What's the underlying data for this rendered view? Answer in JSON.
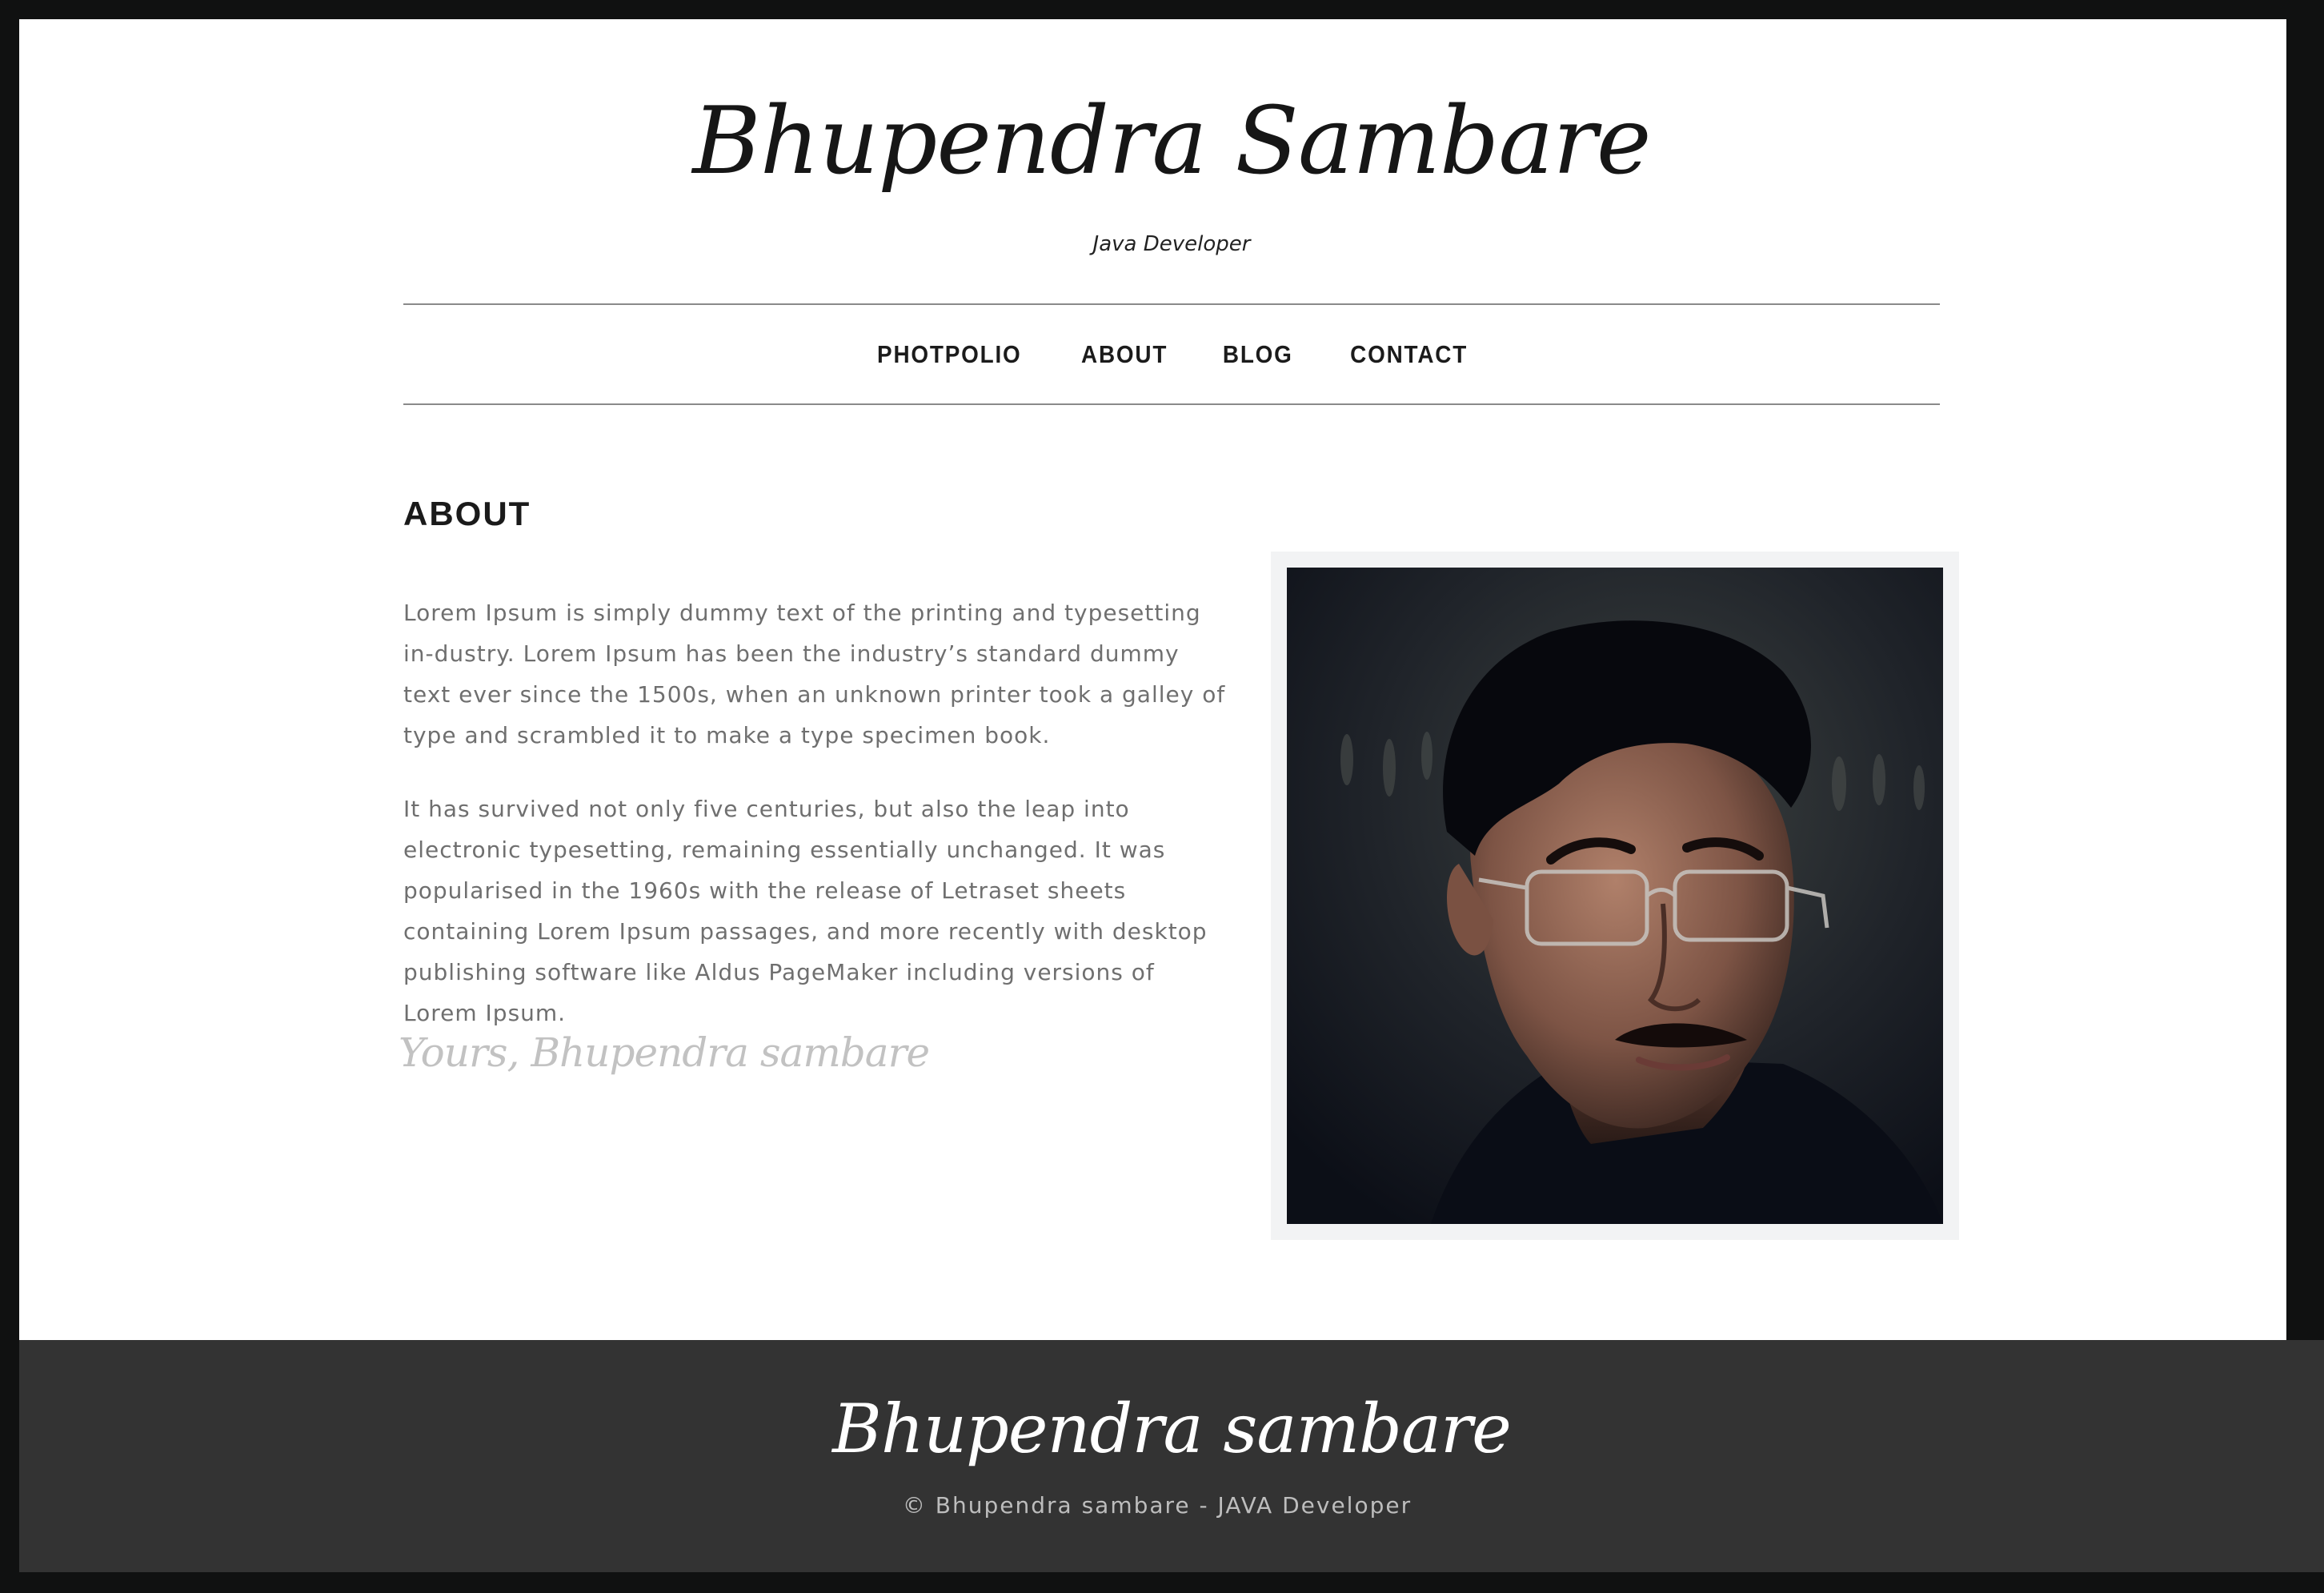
{
  "header": {
    "site_title": "Bhupendra Sambare",
    "site_subtitle": "Java Developer"
  },
  "nav": {
    "items": [
      {
        "label": "PHOTPOLIO"
      },
      {
        "label": "ABOUT"
      },
      {
        "label": "BLOG"
      },
      {
        "label": "CONTACT"
      }
    ]
  },
  "about": {
    "heading": "ABOUT",
    "paragraphs": [
      "Lorem Ipsum is simply dummy text of the printing and typesetting in-dustry. Lorem Ipsum has been the industry’s standard dummy text ever since the 1500s, when an unknown printer took a galley of type and scrambled it to make a type specimen book.",
      "It has survived not only five centuries, but also the leap into electronic typesetting, remaining essentially unchanged. It was popularised in the 1960s with the release of Letraset sheets containing Lorem Ipsum passages, and more recently with desktop publishing software like Aldus PageMaker including versions of Lorem Ipsum."
    ],
    "signature": "Yours, Bhupendra sambare",
    "photo_alt": "portrait-photo"
  },
  "footer": {
    "title": "Bhupendra sambare",
    "copyright": "© Bhupendra sambare - JAVA Developer"
  }
}
